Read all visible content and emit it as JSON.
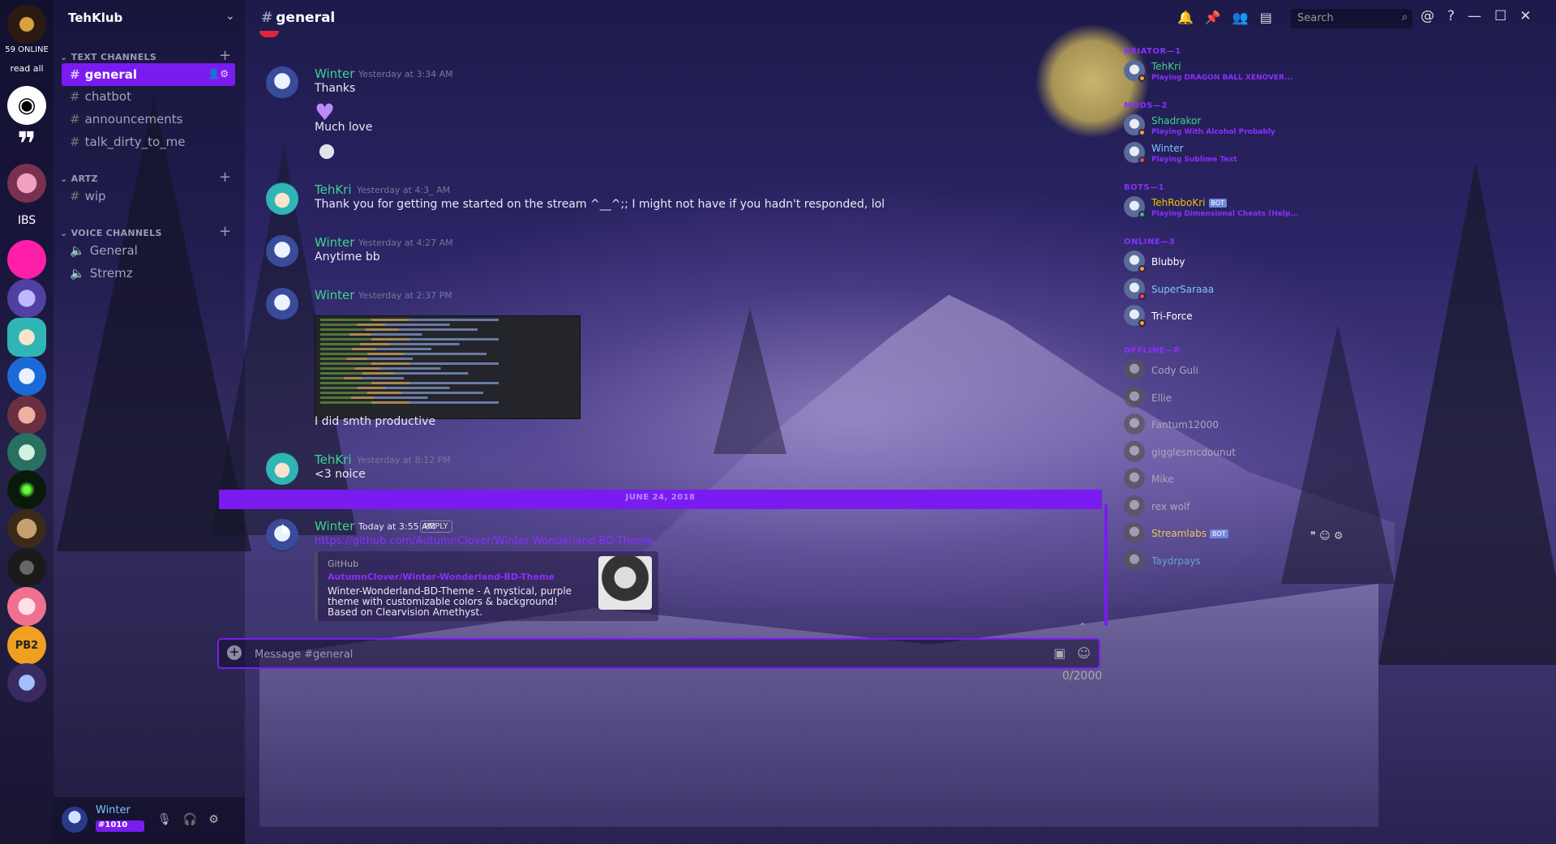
{
  "rail": {
    "online": "59 ONLINE",
    "read_all": "read all",
    "ibs": "IBS",
    "pb2": "PB2"
  },
  "sidebar": {
    "guild_name": "TehKlub",
    "text_category": "TEXT CHANNELS",
    "text_channels": [
      "general",
      "chatbot",
      "announcements",
      "talk_dirty_to_me"
    ],
    "artz_category": "ARTZ",
    "artz_channels": [
      "wip"
    ],
    "voice_category": "VOICE CHANNELS",
    "voice_channels": [
      "General",
      "Stremz"
    ]
  },
  "user": {
    "name": "Winter",
    "tag": "#1010"
  },
  "header": {
    "channel": "general",
    "search_placeholder": "Search"
  },
  "messages": [
    {
      "author": "Winter",
      "time": "Yesterday at 3:34 AM",
      "lines": [
        "Thanks",
        "Much love"
      ]
    },
    {
      "author": "TehKri",
      "time": "Yesterday at 4:3_ AM",
      "lines": [
        "Thank you for getting me started on the stream ^__^;; I might not have if you hadn't responded, lol"
      ]
    },
    {
      "author": "Winter",
      "time": "Yesterday at 4:27 AM",
      "lines": [
        "Anytime bb"
      ]
    },
    {
      "author": "Winter",
      "time": "Yesterday at 2:37 PM",
      "lines": [
        "I did smth productive"
      ]
    },
    {
      "author": "TehKri",
      "time": "Yesterday at 8:12 PM",
      "lines": [
        "<3 noice"
      ]
    }
  ],
  "date_divider": "JUNE 24, 2018",
  "last_message": {
    "author": "Winter",
    "time": "Today at 3:55 AM",
    "reply": "REPLY",
    "link": "https://github.com/AutumnClover/Winter-Wonderland-BD-Theme",
    "embed": {
      "provider": "GitHub",
      "title": "AutumnClover/Winter-Wonderland-BD-Theme",
      "description": "Winter-Wonderland-BD-Theme - A mystical, purple theme with customizable colors & background! Based on Clearvision Amethyst."
    }
  },
  "composer": {
    "placeholder": "Message #general",
    "char_count": "0/2000"
  },
  "members": {
    "roles": [
      {
        "label": "KRIATOR—1",
        "members": [
          {
            "name": "TehKri",
            "color": "#3bd58f",
            "game": "Playing DRAGON BALL XENOVER...",
            "status": "#faa61a"
          }
        ]
      },
      {
        "label": "MODS—2",
        "members": [
          {
            "name": "Shadrakor",
            "color": "#3bd58f",
            "game": "Playing With Alcohol Probably",
            "status": "#faa61a"
          },
          {
            "name": "Winter",
            "color": "#7bc6ff",
            "game": "Playing Sublime Text",
            "status": "#f04747"
          }
        ]
      },
      {
        "label": "BOTS—1",
        "members": [
          {
            "name": "TehRoboKri",
            "color": "#f0c000",
            "game": "Playing Dimensional Cheats (Help...",
            "status": "#43b581",
            "bot": "BOT"
          }
        ]
      },
      {
        "label": "ONLINE—3",
        "members": [
          {
            "name": "Blubby",
            "color": "#ffffff",
            "game": "",
            "status": "#faa61a"
          },
          {
            "name": "SuperSaraaa",
            "color": "#7bc6ff",
            "game": "",
            "status": "#f04747"
          },
          {
            "name": "Tri-Force",
            "color": "#ffffff",
            "game": "",
            "status": "#faa61a"
          }
        ]
      },
      {
        "label": "OFFLINE—8",
        "members": [
          {
            "name": "Cody Guli",
            "color": "#a8a8b8",
            "game": "",
            "status": ""
          },
          {
            "name": "Ellie",
            "color": "#a8a8b8",
            "game": "",
            "status": ""
          },
          {
            "name": "Fantum12000",
            "color": "#a8a8b8",
            "game": "",
            "status": ""
          },
          {
            "name": "gigglesmcdounut",
            "color": "#a8a8b8",
            "game": "",
            "status": ""
          },
          {
            "name": "Mike",
            "color": "#a8a8b8",
            "game": "",
            "status": ""
          },
          {
            "name": "rex wolf",
            "color": "#a8a8b8",
            "game": "",
            "status": ""
          },
          {
            "name": "Streamlabs",
            "color": "#e6c85a",
            "game": "",
            "status": "",
            "bot": "BOT"
          },
          {
            "name": "Taydrpays",
            "color": "#6aa2c8",
            "game": "",
            "status": ""
          }
        ]
      }
    ]
  },
  "colors": {
    "accent": "#7a1cf0",
    "author_green": "#3bd58f",
    "link": "#8a2fff"
  }
}
